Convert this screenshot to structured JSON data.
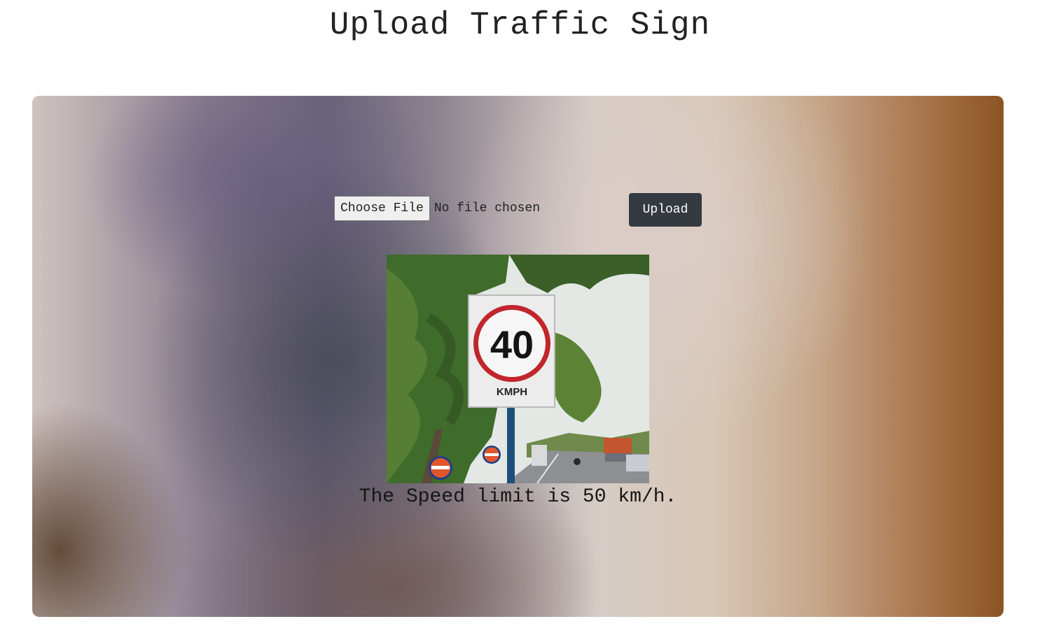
{
  "page": {
    "title": "Upload Traffic Sign"
  },
  "upload_form": {
    "choose_file_label": "Choose File",
    "file_status": "No file chosen",
    "upload_label": "Upload"
  },
  "preview": {
    "sign_number": "40",
    "sign_unit": "KMPH"
  },
  "result": {
    "text": "The Speed limit is 50 km/h."
  },
  "colors": {
    "upload_button_bg": "#343a40",
    "sign_ring": "#c0262c"
  }
}
